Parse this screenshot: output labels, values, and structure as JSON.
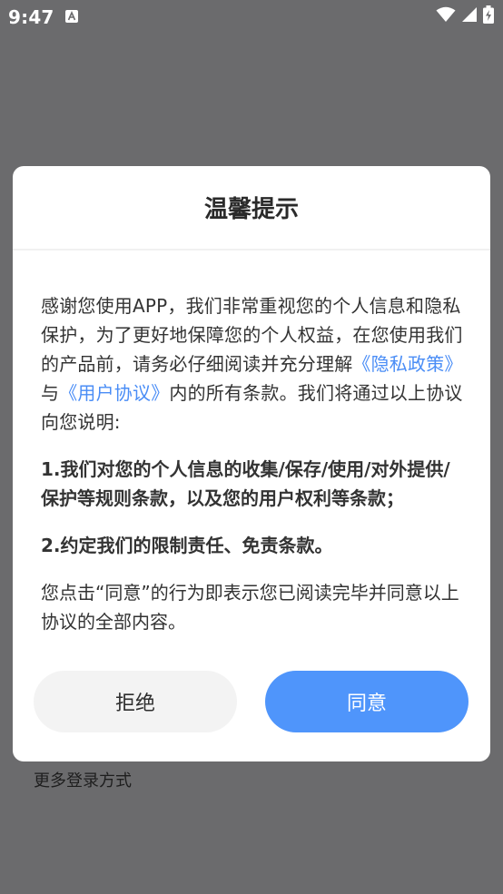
{
  "status_bar": {
    "time": "9:47",
    "notification_icon": "a-notification-icon",
    "wifi_icon": "wifi-icon",
    "signal_icon": "signal-icon",
    "battery_icon": "battery-charging-icon"
  },
  "background": {
    "more_login": "更多登录方式"
  },
  "dialog": {
    "title": "温馨提示",
    "intro_before_privacy": "感谢您使用APP，我们非常重视您的个人信息和隐私保护，为了更好地保障您的个人权益，在您使用我们的产品前，请务必仔细阅读并充分理解",
    "privacy_link": "《隐私政策》",
    "connector": "与",
    "agreement_link": "《用户协议》",
    "intro_after_agreement": "内的所有条款。我们将通过以上协议向您说明:",
    "item_1": "1.我们对您的个人信息的收集/保存/使用/对外提供/保护等规则条款，以及您的用户权利等条款；",
    "item_2": "2.约定我们的限制责任、免责条款。",
    "closing": "您点击“同意”的行为即表示您已阅读完毕并同意以上协议的全部内容。",
    "reject_label": "拒绝",
    "agree_label": "同意"
  },
  "colors": {
    "overlay": "#6b6b6d",
    "link": "#4a8df6",
    "agree_button": "#4f95fb",
    "reject_button": "#f3f3f3"
  }
}
